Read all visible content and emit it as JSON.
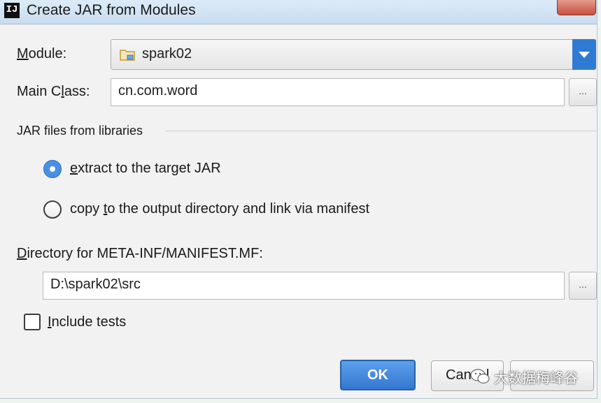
{
  "window": {
    "title": "Create JAR from Modules",
    "app_icon_text": "IJ"
  },
  "module": {
    "label": "Module:",
    "value": "spark02"
  },
  "main_class": {
    "label": "Main Class:",
    "value": "cn.com.word",
    "browse_label": "..."
  },
  "libraries": {
    "section_title": "JAR files from libraries",
    "option_extract": "extract to the target JAR",
    "option_copy": "copy to the output directory and link via manifest",
    "selected": "extract"
  },
  "manifest": {
    "label": "Directory for META-INF/MANIFEST.MF:",
    "value": "D:\\spark02\\src",
    "browse_label": "..."
  },
  "include_tests": {
    "label": "Include tests",
    "checked": false
  },
  "buttons": {
    "ok": "OK",
    "cancel": "Cancel"
  },
  "watermark": {
    "text": "大数据梅峰谷"
  },
  "colors": {
    "accent": "#3477cf",
    "background": "#f2f2f2"
  }
}
